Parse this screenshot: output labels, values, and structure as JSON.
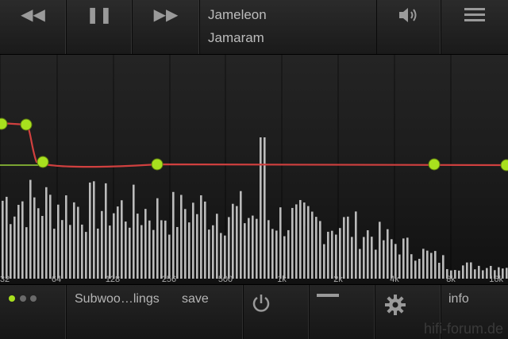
{
  "transport": {
    "rewind_icon": "rewind-icon",
    "pause_icon": "pause-icon",
    "forward_icon": "fast-forward-icon"
  },
  "track": {
    "title": "Jameleon",
    "artist": "Jamaram"
  },
  "top_right": {
    "volume_icon": "volume-icon",
    "menu_icon": "menu-icon"
  },
  "freq_labels": [
    "32",
    "64",
    "128",
    "256",
    "500",
    "1k",
    "2k",
    "4k",
    "8k",
    "16k"
  ],
  "bottom": {
    "preset_label": "Subwoo…lings",
    "save_label": "save",
    "info_label": "info",
    "power_icon": "power-icon",
    "minus_icon": "minus-icon",
    "gear_icon": "gear-icon"
  },
  "watermark": "hifi-forum.de",
  "colors": {
    "curve": "#d0403f",
    "node": "#a8e01e",
    "flat_line": "#9ad23a",
    "bars": "#d8d8d8",
    "page_dot_active": "#a8e01e",
    "page_dot_inactive": "#6a6a6a"
  }
}
